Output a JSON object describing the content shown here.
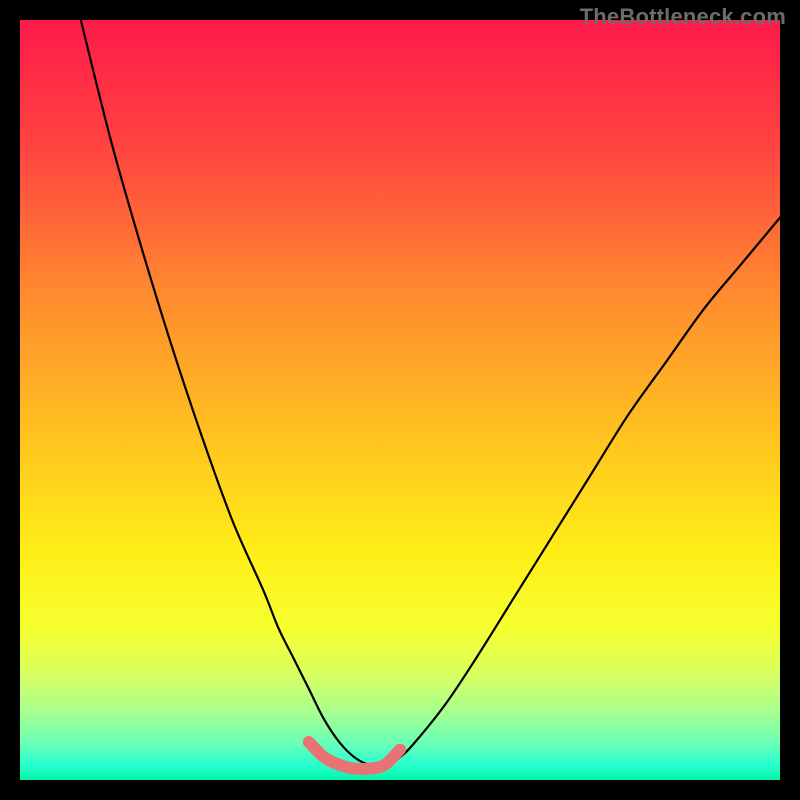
{
  "watermark": "TheBottleneck.com",
  "chart_data": {
    "type": "line",
    "title": "",
    "xlabel": "",
    "ylabel": "",
    "xlim": [
      0,
      100
    ],
    "ylim": [
      0,
      100
    ],
    "series": [
      {
        "name": "black-curve",
        "x": [
          8,
          12,
          16,
          20,
          24,
          28,
          32,
          34,
          36,
          38,
          40,
          42,
          44,
          46,
          48,
          50,
          52,
          56,
          60,
          65,
          70,
          75,
          80,
          85,
          90,
          95,
          100
        ],
        "y": [
          100,
          84,
          70,
          57,
          45,
          34,
          25,
          20,
          16,
          12,
          8,
          5,
          3,
          2,
          2,
          3,
          5,
          10,
          16,
          24,
          32,
          40,
          48,
          55,
          62,
          68,
          74
        ]
      },
      {
        "name": "pink-highlight",
        "x": [
          38,
          40,
          42,
          44,
          46,
          48,
          50
        ],
        "y": [
          5,
          3,
          2,
          1.5,
          1.5,
          2,
          4
        ]
      }
    ],
    "background_gradient": {
      "stops": [
        {
          "offset": 0.0,
          "color": "#ff1a4a"
        },
        {
          "offset": 0.18,
          "color": "#ff483f"
        },
        {
          "offset": 0.36,
          "color": "#ff8a2f"
        },
        {
          "offset": 0.54,
          "color": "#ffc020"
        },
        {
          "offset": 0.7,
          "color": "#ffee17"
        },
        {
          "offset": 0.8,
          "color": "#f6ff30"
        },
        {
          "offset": 0.86,
          "color": "#d9ff60"
        },
        {
          "offset": 0.91,
          "color": "#a9ff8f"
        },
        {
          "offset": 0.95,
          "color": "#6cffb5"
        },
        {
          "offset": 0.98,
          "color": "#28ffcf"
        },
        {
          "offset": 1.0,
          "color": "#00f5a8"
        }
      ]
    }
  }
}
